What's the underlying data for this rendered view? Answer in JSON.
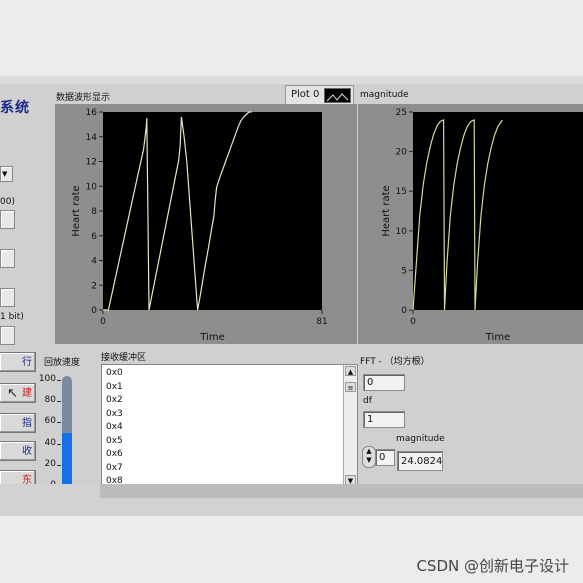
{
  "app": {
    "title_fragment": "系统"
  },
  "left_controls": {
    "fragment_00": "00)",
    "fragment_1bit": "1 bit)",
    "playback_speed_label": "回放速度",
    "buttons": [
      {
        "label": "行",
        "color": "#1a2a8c"
      },
      {
        "label": "建",
        "color": "#d01818"
      },
      {
        "label": "指",
        "color": "#1a2a8c"
      },
      {
        "label": "收",
        "color": "#1a2a8c"
      },
      {
        "label": "东",
        "color": "#d01818"
      }
    ]
  },
  "speed_gauge": {
    "ticks": [
      "100",
      "80",
      "60",
      "40",
      "20",
      "0"
    ],
    "value": 50,
    "max": 100,
    "fill_color": "#1670e8"
  },
  "waveform_panel": {
    "title": "数据波形显示",
    "legend": "Plot 0"
  },
  "receive_buffer": {
    "title": "接收缓冲区",
    "items": [
      "0x0",
      "0x1",
      "0x2",
      "0x3",
      "0x4",
      "0x5",
      "0x6",
      "0x7",
      "0x8"
    ]
  },
  "magnitude_panel": {
    "title": "magnitude"
  },
  "fft_panel": {
    "title": "FFT - （均方根）",
    "field_top": "0",
    "df_label": "df",
    "df_value": "1",
    "magnitude_label": "magnitude",
    "index_value": "0",
    "magnitude_value": "24.0824"
  },
  "watermark": "CSDN @创新电子设计",
  "chart_data": [
    {
      "type": "line",
      "title": "",
      "xlabel": "Time",
      "ylabel": "Heart rate",
      "xlim": [
        0,
        81
      ],
      "ylim": [
        0,
        16
      ],
      "y_ticks": [
        "0",
        "2",
        "4",
        "6",
        "8",
        "10",
        "12",
        "14",
        "16"
      ],
      "x_ticks": [
        "0",
        "81"
      ],
      "line_color": "#e6e6c8",
      "series": [
        {
          "x": [
            0,
            2,
            3,
            4,
            5,
            6,
            7,
            8,
            9,
            10,
            11,
            12,
            13,
            14,
            15,
            16,
            16.2,
            16.5,
            17,
            18,
            19,
            20,
            21,
            22,
            23,
            24,
            25,
            26,
            27,
            28,
            28.5,
            29,
            30,
            31,
            32,
            33,
            34,
            35,
            36,
            37,
            38,
            39,
            40,
            41,
            41.5,
            42,
            43,
            44,
            45,
            46,
            47,
            48,
            49,
            50,
            51,
            52,
            53,
            54,
            55
          ],
          "y": [
            0,
            0,
            1.0,
            2.0,
            3.0,
            4.0,
            5.0,
            6.0,
            7.0,
            8.0,
            9.0,
            10.0,
            11.0,
            12.0,
            13.0,
            14.8,
            15.5,
            10,
            0,
            1.1,
            2.2,
            3.3,
            4.4,
            5.5,
            6.6,
            7.7,
            8.8,
            9.9,
            11.0,
            12.1,
            13.2,
            15.6,
            14.0,
            12.0,
            9.0,
            6.0,
            3.0,
            0,
            1.2,
            2.5,
            3.8,
            5.0,
            6.3,
            7.6,
            8.9,
            9.9,
            10.6,
            11.2,
            11.8,
            12.4,
            13.0,
            13.6,
            14.2,
            14.8,
            15.3,
            15.6,
            15.8,
            16.0,
            16.0
          ]
        }
      ]
    },
    {
      "type": "line",
      "title": "",
      "xlabel": "Time",
      "ylabel": "Heart rate",
      "xlim": [
        0,
        100
      ],
      "ylim": [
        0,
        25
      ],
      "y_ticks": [
        "0",
        "5",
        "10",
        "15",
        "20",
        "25"
      ],
      "x_ticks": [
        "0"
      ],
      "line_color": "#d8d89a",
      "series": [
        {
          "x": [
            0,
            2,
            4,
            6,
            8,
            10,
            12,
            14,
            16,
            18,
            18.5,
            20,
            22,
            24,
            26,
            28,
            30,
            32,
            34,
            36,
            36.5,
            38,
            40,
            42,
            44,
            46,
            48,
            50,
            52,
            52.5
          ],
          "y": [
            0,
            6,
            12,
            15.8,
            18.5,
            20.5,
            22.1,
            23.2,
            23.8,
            24.0,
            0,
            6,
            12,
            15.8,
            18.5,
            20.5,
            22.1,
            23.2,
            23.8,
            24.0,
            0,
            6,
            12,
            15.8,
            18.5,
            20.5,
            22.1,
            23.2,
            23.8,
            24.0
          ]
        }
      ]
    }
  ]
}
